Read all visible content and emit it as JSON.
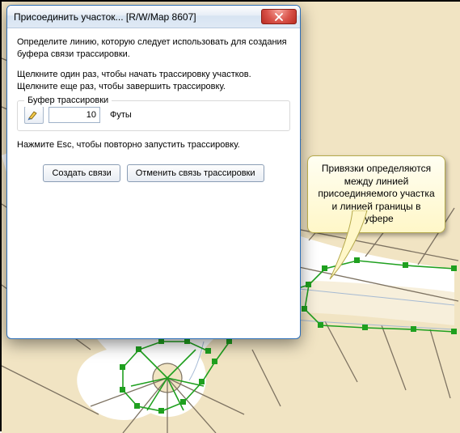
{
  "dialog": {
    "title": "Присоединить участок... [R/W/Map 8607]",
    "close_glyph": "✕",
    "instruction1": "Определите линию, которую следует использовать для создания буфера связи трассировки.",
    "instruction2": "Щелкните один раз, чтобы начать трассировку участков. Щелкните еще раз, чтобы завершить трассировку.",
    "group_label": "Буфер трассировки",
    "buffer_value": "10",
    "units_label": "Футы",
    "esc_hint": "Нажмите Esc, чтобы повторно запустить трассировку.",
    "create_button": "Создать связи",
    "cancel_button": "Отменить связь трассировки"
  },
  "callout": {
    "text": "Привязки определяются между линией присоединяемого участка и линией границы в буфере"
  },
  "map": {
    "parcel_fill": "#f1e4c3",
    "road_fill": "#ffffff",
    "parcel_stroke": "#7d7261",
    "trace_stroke": "#1fa01f",
    "trace_handle_fill": "#1fa01f",
    "buffer_stroke": "#8aa2c2"
  }
}
